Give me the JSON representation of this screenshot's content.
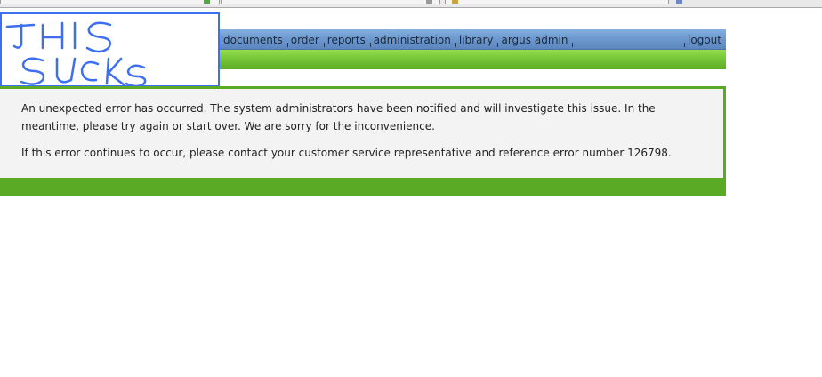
{
  "nav": {
    "items": [
      {
        "label": "documents"
      },
      {
        "label": "order"
      },
      {
        "label": "reports"
      },
      {
        "label": "administration"
      },
      {
        "label": "library"
      },
      {
        "label": "argus admin"
      }
    ],
    "logout_label": "logout"
  },
  "logo": {
    "scribble_text": "THIS SUCKS",
    "ink_color": "#3d6ff0"
  },
  "error": {
    "message": "An unexpected error has occurred. The system administrators have been notified and will investigate this issue. In the meantime, please try again or start over. We are sorry for the inconvenience.",
    "contact": "If this error continues to occur, please contact your customer service representative and reference error number 126798."
  },
  "colors": {
    "nav_blue": "#6f9ad0",
    "accent_green": "#5aaa25",
    "panel_bg": "#f3f3f3"
  }
}
